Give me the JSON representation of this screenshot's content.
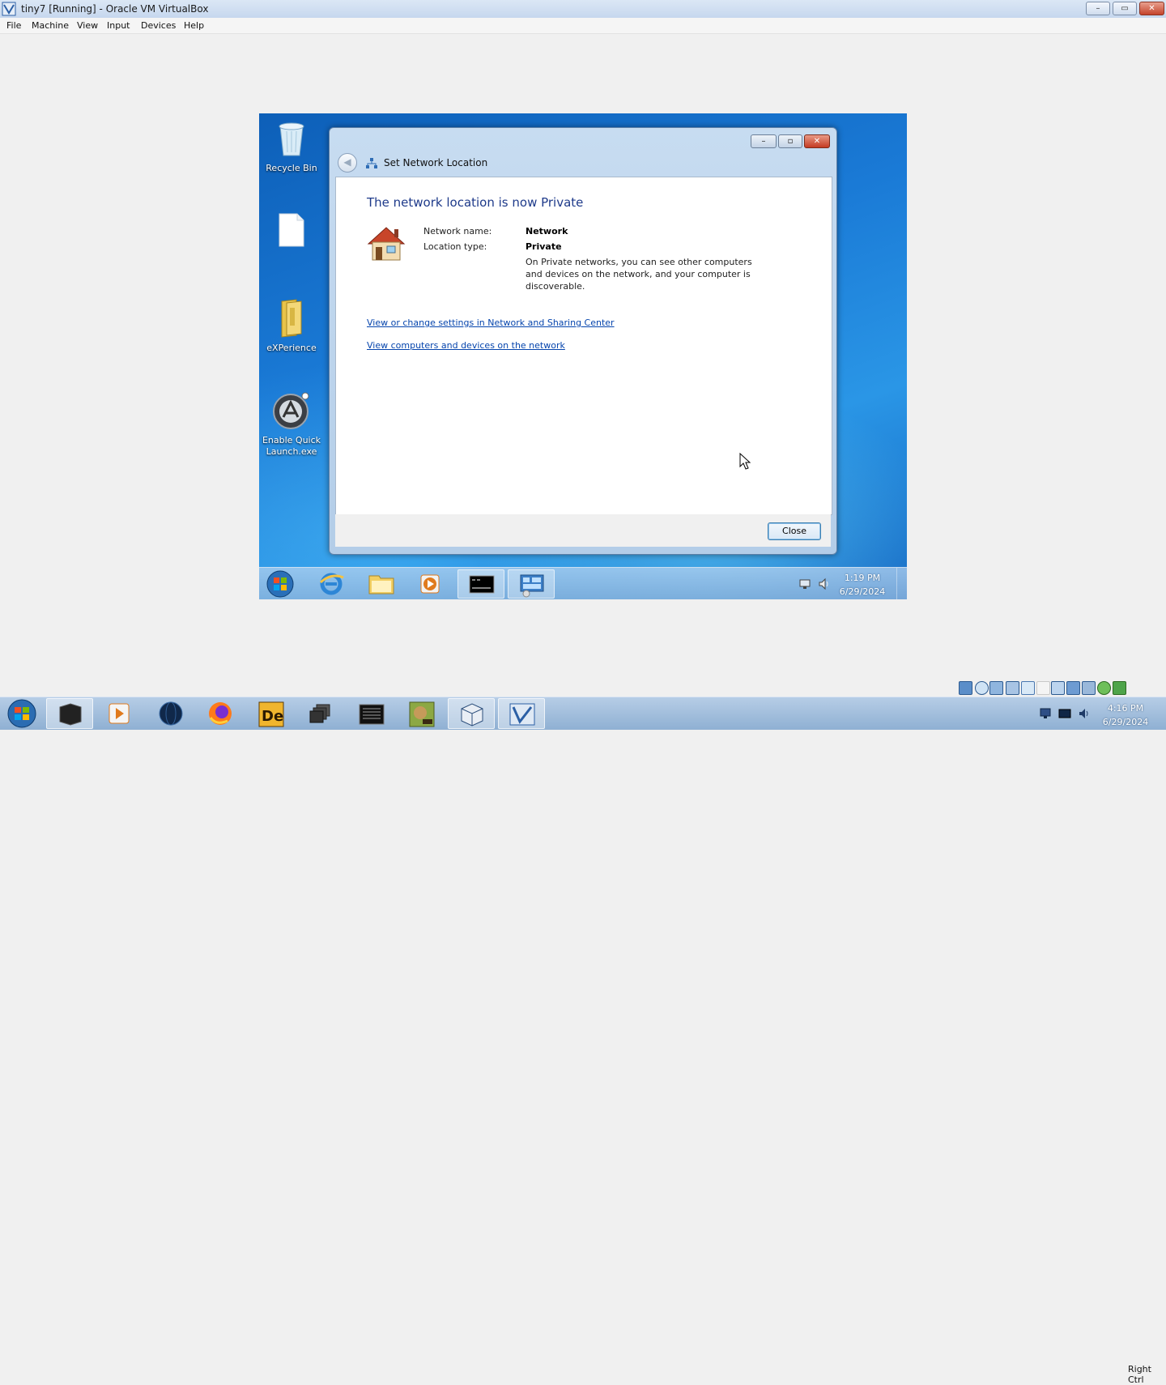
{
  "host": {
    "title": "tiny7 [Running] - Oracle VM VirtualBox",
    "menu": [
      "File",
      "Machine",
      "View",
      "Input",
      "Devices",
      "Help"
    ],
    "window_buttons": {
      "minimize": "–",
      "restore": "▭",
      "close": "✕"
    },
    "status": {
      "host_key": "Right Ctrl"
    },
    "taskbar": {
      "clock_time": "4:16 PM",
      "clock_date": "6/29/2024",
      "apps": [
        "start-orb",
        "black-box-app",
        "media-player",
        "dark-globe",
        "firefox",
        "davinci-resolve",
        "stacked-windows",
        "terminal",
        "dosbox",
        "virtualbox",
        "tiny7-vm"
      ]
    }
  },
  "guest": {
    "desktop_icons": [
      {
        "label": "Recycle Bin",
        "icon": "recycle-bin-icon"
      },
      {
        "label": "",
        "icon": "blank-document-icon"
      },
      {
        "label": "eXPerience",
        "icon": "folder-icon"
      },
      {
        "label": "Enable Quick Launch.exe",
        "icon": "quicklaunch-icon"
      }
    ],
    "dialog": {
      "title": "Set Network Location",
      "heading": "The network location is now Private",
      "network_name_label": "Network name:",
      "network_name_value": "Network",
      "location_type_label": "Location type:",
      "location_type_value": "Private",
      "description": "On Private networks, you can see other computers and devices on the network, and your computer is discoverable.",
      "link1": "View or change settings in Network and Sharing Center",
      "link2": "View computers and devices on the network",
      "close_label": "Close",
      "window_buttons": {
        "minimize": "–",
        "maximize": "▫",
        "close": "✕"
      },
      "back_glyph": "◀"
    },
    "taskbar": {
      "clock_time": "1:19 PM",
      "clock_date": "6/29/2024",
      "apps": [
        "start-orb",
        "internet-explorer",
        "explorer-folder",
        "media-player",
        "cmd",
        "control-panel"
      ]
    }
  },
  "colors": {
    "link": "#0645ad",
    "heading": "#1e3a8a",
    "guest_desktop": "#1a7ad6"
  }
}
